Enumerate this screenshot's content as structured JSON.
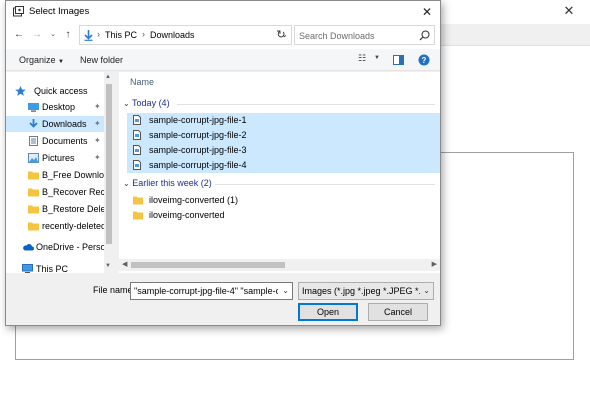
{
  "dialog": {
    "title": "Select Images",
    "address": {
      "crumbs": [
        "This PC",
        "Downloads"
      ]
    },
    "search": {
      "placeholder": "Search Downloads"
    },
    "toolbar": {
      "organize_label": "Organize",
      "new_folder_label": "New folder"
    },
    "nav_pane": {
      "items": [
        {
          "label": "Quick access",
          "icon": "star-icon"
        },
        {
          "label": "Desktop",
          "icon": "desktop-icon"
        },
        {
          "label": "Downloads",
          "icon": "download-icon"
        },
        {
          "label": "Documents",
          "icon": "documents-icon"
        },
        {
          "label": "Pictures",
          "icon": "pictures-icon"
        },
        {
          "label": "B_Free Download",
          "icon": "folder-icon"
        },
        {
          "label": "B_Recover Recen",
          "icon": "folder-icon"
        },
        {
          "label": "B_Restore Delete",
          "icon": "folder-icon"
        },
        {
          "label": "recently-deleted-",
          "icon": "folder-icon"
        },
        {
          "label": "OneDrive - Person",
          "icon": "cloud-icon"
        },
        {
          "label": "This PC",
          "icon": "computer-icon"
        }
      ],
      "selected_index": 2
    },
    "file_list": {
      "column_header": "Name",
      "groups": [
        {
          "header": "Today (4)",
          "files": [
            {
              "name": "sample-corrupt-jpg-file-1",
              "selected": true
            },
            {
              "name": "sample-corrupt-jpg-file-2",
              "selected": true
            },
            {
              "name": "sample-corrupt-jpg-file-3",
              "selected": true
            },
            {
              "name": "sample-corrupt-jpg-file-4",
              "selected": true
            }
          ]
        },
        {
          "header": "Earlier this week (2)",
          "files": [
            {
              "name": "iloveimg-converted (1)",
              "selected": false
            },
            {
              "name": "iloveimg-converted",
              "selected": false
            }
          ]
        }
      ]
    },
    "bottom": {
      "file_name_label": "File name:",
      "file_name_value": "\"sample-corrupt-jpg-file-4\" \"sample-co",
      "file_type_value": "Images (*.jpg *.jpeg *.JPEG *.JPG",
      "open_label": "Open",
      "cancel_label": "Cancel"
    },
    "colors": {
      "selection": "#cce8ff",
      "group_header": "#1e3287",
      "accent": "#0078d7"
    }
  }
}
